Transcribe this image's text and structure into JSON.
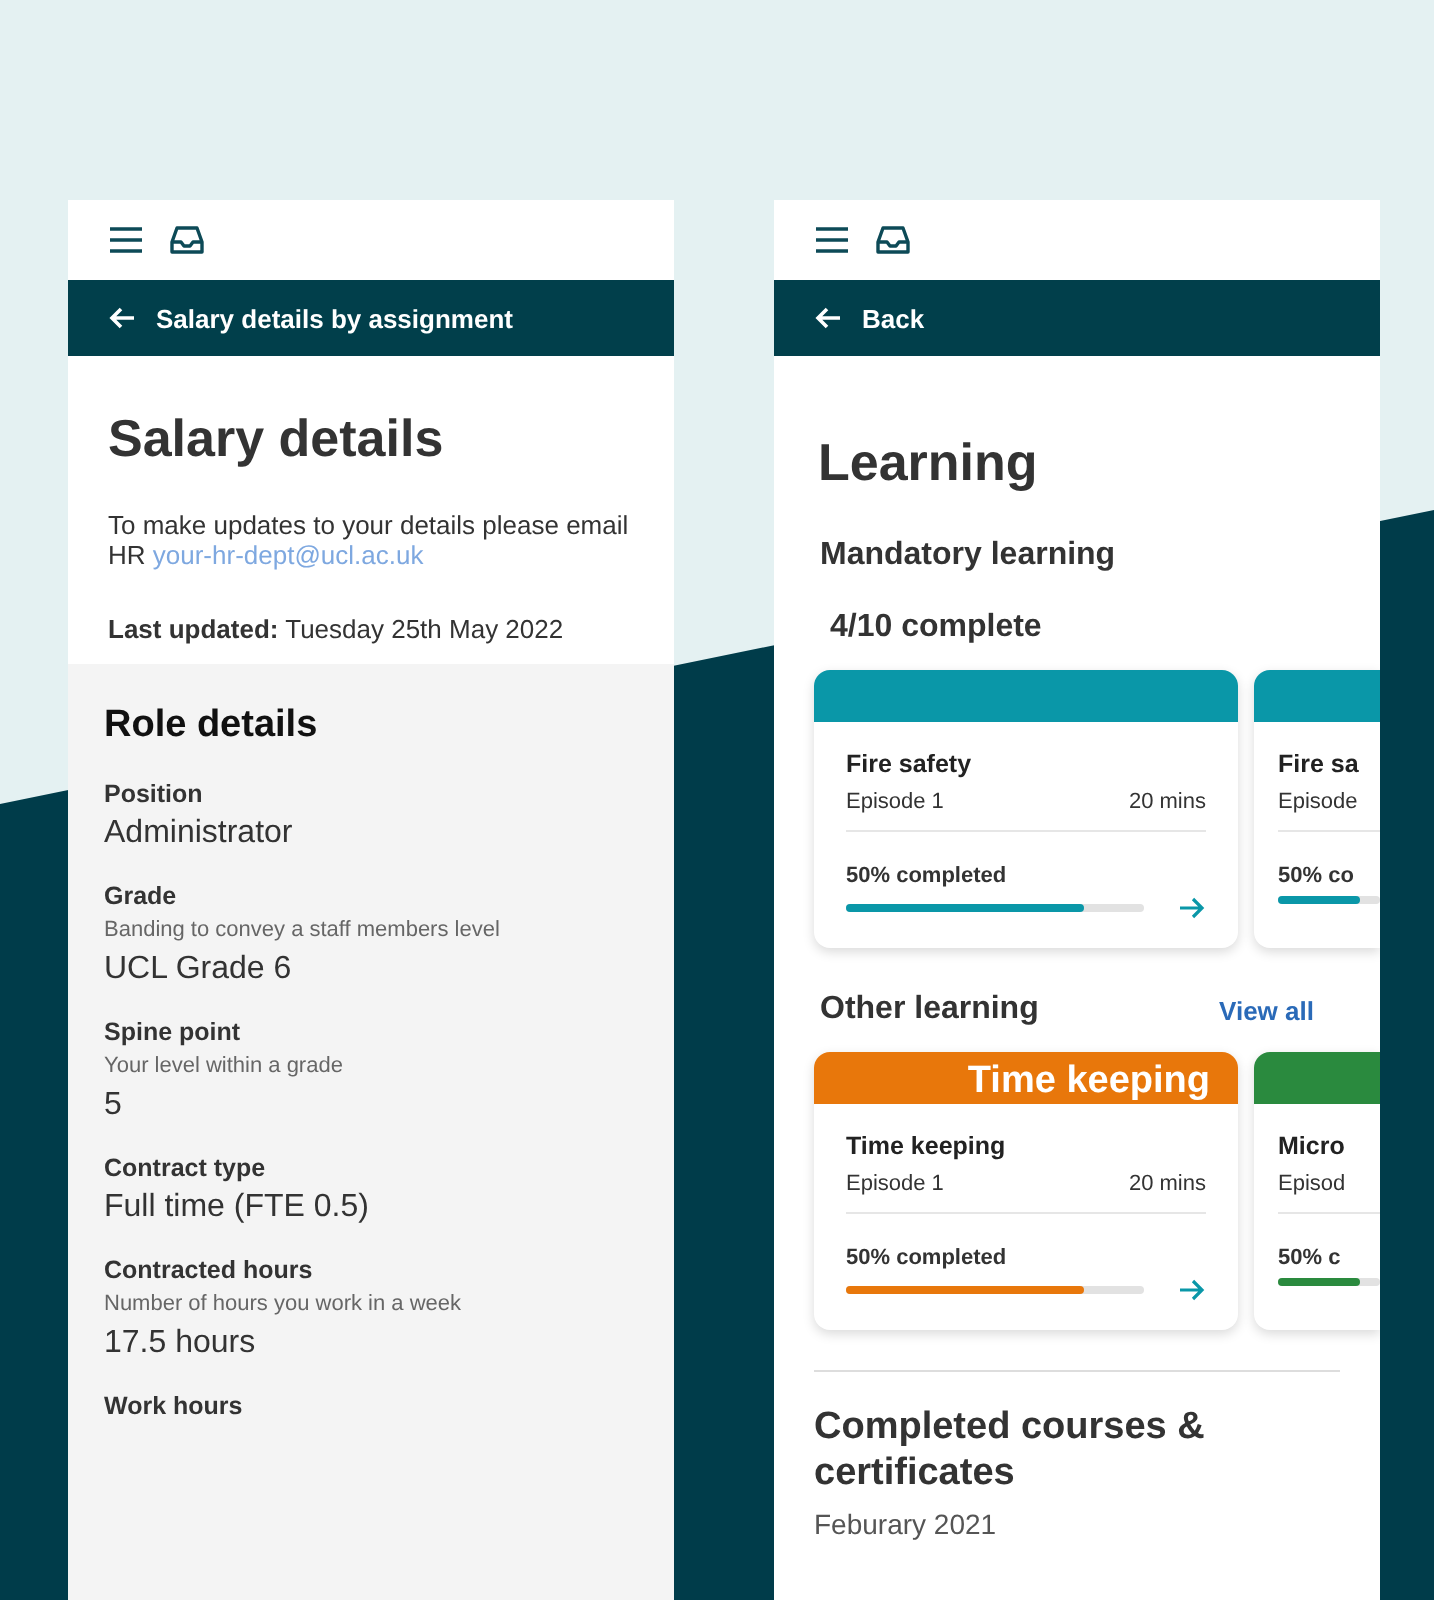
{
  "salary_screen": {
    "nav_title": "Salary details by assignment",
    "title": "Salary details",
    "intro": "To make updates to your details please email HR",
    "email": "your-hr-dept@ucl.ac.uk",
    "last_updated_label": "Last updated:",
    "last_updated_value": "Tuesday 25th May 2022",
    "section_title": "Role details",
    "fields": [
      {
        "label": "Position",
        "value": "Administrator"
      },
      {
        "label": "Grade",
        "hint": "Banding to convey a staff members level",
        "value": "UCL Grade 6"
      },
      {
        "label": "Spine point",
        "hint": "Your level within a grade",
        "value": "5"
      },
      {
        "label": "Contract type",
        "value": "Full time (FTE 0.5)"
      },
      {
        "label": "Contracted hours",
        "hint": "Number of hours you work in a week",
        "value": "17.5 hours"
      },
      {
        "label": "Work hours"
      }
    ]
  },
  "learning_screen": {
    "nav_title": "Back",
    "title": "Learning",
    "mandatory": {
      "title": "Mandatory learning",
      "progress": "4/10 complete",
      "cards": [
        {
          "title": "Fire safety",
          "episode": "Episode 1",
          "duration": "20 mins",
          "progress_label": "50% completed",
          "level": 0.8,
          "color": "#0a97a8"
        },
        {
          "title": "Fire sa",
          "episode": "Episode",
          "progress_label": "50% co",
          "level": 0.8,
          "color": "#0a97a8"
        }
      ]
    },
    "other": {
      "title": "Other learning",
      "link": "View all",
      "cards": [
        {
          "banner": "Time keeping",
          "title": "Time keeping",
          "episode": "Episode 1",
          "duration": "20 mins",
          "progress_label": "50% completed",
          "level": 0.8,
          "color": "#e8770b"
        },
        {
          "title": "Micro",
          "episode": "Episod",
          "progress_label": "50% c",
          "level": 0.8,
          "color": "#2a8a3e"
        }
      ]
    },
    "completed": {
      "title": "Completed courses & certificates",
      "date": "Feburary 2021"
    }
  }
}
